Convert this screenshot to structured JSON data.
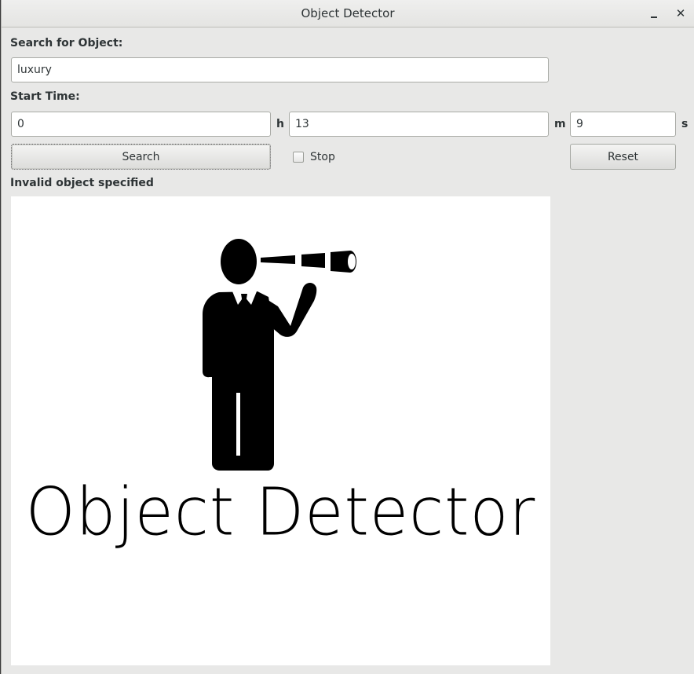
{
  "window": {
    "title": "Object Detector",
    "minimize_icon": "minimize-icon",
    "close_icon": "close-icon",
    "close_glyph": "✕"
  },
  "search": {
    "label": "Search for Object:",
    "value": "luxury"
  },
  "start_time": {
    "label": "Start Time:",
    "hours_value": "0",
    "hours_unit": "h",
    "minutes_value": "13",
    "minutes_unit": "m",
    "seconds_value": "9",
    "seconds_unit": "s"
  },
  "controls": {
    "search_button": "Search",
    "stop_label": "Stop",
    "stop_checked": false,
    "reset_button": "Reset"
  },
  "status": {
    "message": "Invalid object specified"
  },
  "image": {
    "logo_text": "Object Detector",
    "icon": "man-with-telescope-icon"
  }
}
